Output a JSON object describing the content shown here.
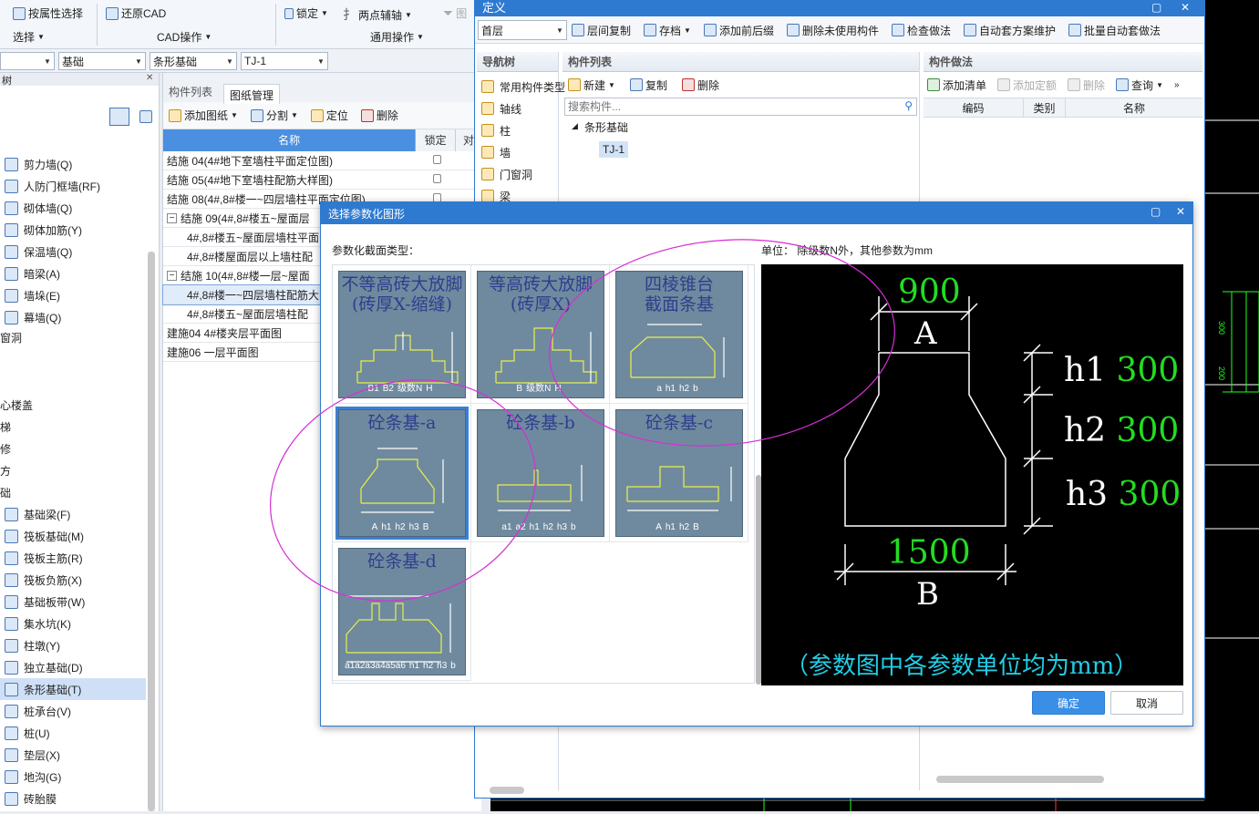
{
  "ribbon": {
    "select_by_attr": "按属性选择",
    "restore_cad": "还原CAD",
    "lock": "锁定",
    "two_point_aux": "两点辅轴",
    "select_group": "选择",
    "cad_ops_group": "CAD操作",
    "general_ops_group": "通用操作"
  },
  "filter_bar": {
    "combo1": "",
    "combo2": "基础",
    "combo3": "条形基础",
    "combo4": "TJ-1"
  },
  "left_nav": {
    "header": "树",
    "items": [
      {
        "label": "剪力墙(Q)",
        "icon": "shear-wall-icon"
      },
      {
        "label": "人防门框墙(RF)",
        "icon": "civil-defense-door-icon"
      },
      {
        "label": "砌体墙(Q)",
        "icon": "masonry-wall-icon"
      },
      {
        "label": "砌体加筋(Y)",
        "icon": "masonry-rebar-icon"
      },
      {
        "label": "保温墙(Q)",
        "icon": "insulation-wall-icon"
      },
      {
        "label": "暗梁(A)",
        "icon": "hidden-beam-icon"
      },
      {
        "label": "墙垛(E)",
        "icon": "wall-pier-icon"
      },
      {
        "label": "幕墙(Q)",
        "icon": "curtain-wall-icon"
      }
    ],
    "group_labels": [
      "窗洞",
      "心楼盖",
      "梯",
      "修",
      "方",
      "础"
    ],
    "foundation_items": [
      {
        "label": "基础梁(F)",
        "icon": "foundation-beam-icon"
      },
      {
        "label": "筏板基础(M)",
        "icon": "raft-foundation-icon"
      },
      {
        "label": "筏板主筋(R)",
        "icon": "raft-main-rebar-icon"
      },
      {
        "label": "筏板负筋(X)",
        "icon": "raft-neg-rebar-icon"
      },
      {
        "label": "基础板带(W)",
        "icon": "foundation-strip-icon"
      },
      {
        "label": "集水坑(K)",
        "icon": "sump-pit-icon"
      },
      {
        "label": "柱墩(Y)",
        "icon": "column-pier-icon"
      },
      {
        "label": "独立基础(D)",
        "icon": "isolated-foundation-icon"
      },
      {
        "label": "条形基础(T)",
        "icon": "strip-foundation-icon"
      },
      {
        "label": "桩承台(V)",
        "icon": "pile-cap-icon"
      },
      {
        "label": "桩(U)",
        "icon": "pile-icon"
      },
      {
        "label": "垫层(X)",
        "icon": "cushion-icon"
      },
      {
        "label": "地沟(G)",
        "icon": "trench-icon"
      },
      {
        "label": "砖胎膜",
        "icon": "brick-mould-icon"
      }
    ]
  },
  "drawing_panel": {
    "tabs": [
      "构件列表",
      "图纸管理"
    ],
    "toolbar": {
      "add": "添加图纸",
      "split": "分割",
      "locate": "定位",
      "delete": "删除"
    },
    "columns": [
      "名称",
      "锁定",
      "对"
    ],
    "rows": [
      {
        "name": "结施 04(4#地下室墙柱平面定位图)",
        "indent": 0
      },
      {
        "name": "结施 05(4#地下室墙柱配筋大样图)",
        "indent": 0
      },
      {
        "name": "结施 08(4#,8#楼一~四层墙柱平面定位图)",
        "indent": 0
      },
      {
        "name": "结施 09(4#,8#楼五~屋面层",
        "indent": 0,
        "toggle": "−"
      },
      {
        "name": "4#,8#楼五~屋面层墙柱平面",
        "indent": 1
      },
      {
        "name": "4#,8#楼屋面层以上墙柱配",
        "indent": 1
      },
      {
        "name": "结施 10(4#,8#楼一层~屋面",
        "indent": 0,
        "toggle": "−"
      },
      {
        "name": "4#,8#楼一~四层墙柱配筋大",
        "indent": 1,
        "selected": true
      },
      {
        "name": "4#,8#楼五~屋面层墙柱配",
        "indent": 1
      },
      {
        "name": "建施04 4#楼夹层平面图",
        "indent": 0
      },
      {
        "name": "建施06 一层平面图",
        "indent": 0
      }
    ]
  },
  "define_window": {
    "title": "定义",
    "floor": "首层",
    "toolbar": [
      "层间复制",
      "存档",
      "添加前后缀",
      "删除未使用构件",
      "检查做法",
      "自动套方案维护",
      "批量自动套做法"
    ],
    "nav_tree_header": "导航树",
    "nav_tree_items": [
      "常用构件类型",
      "轴线",
      "柱",
      "墙",
      "门窗洞",
      "梁"
    ],
    "component_list_header": "构件列表",
    "component_toolbar": {
      "new": "新建",
      "copy": "复制",
      "delete": "删除"
    },
    "search_placeholder": "搜索构件...",
    "tree_parent": "条形基础",
    "tree_child": "TJ-1",
    "method_header": "构件做法",
    "method_toolbar": {
      "add_list": "添加清单",
      "add_quota": "添加定额",
      "delete": "删除",
      "query": "查询"
    },
    "method_columns": [
      "编码",
      "类别",
      "名称"
    ]
  },
  "dialog": {
    "title": "选择参数化图形",
    "section_label": "参数化截面类型：",
    "unit_note": "单位： 除级数N外，其他参数为mm",
    "shapes": [
      {
        "title1": "不等高砖大放脚",
        "title2": "(砖厚X-缩缝)",
        "labels": [
          "B1",
          "B2",
          "级数N",
          "H"
        ]
      },
      {
        "title1": "等高砖大放脚",
        "title2": "(砖厚X)",
        "labels": [
          "B",
          "级数N",
          "H"
        ]
      },
      {
        "title1": "四棱锥台",
        "title2": "截面条基",
        "labels": [
          "a",
          "h1",
          "h2",
          "b"
        ]
      },
      {
        "title1": "砼条基-a",
        "labels": [
          "A",
          "h1",
          "h2",
          "h3",
          "B"
        ],
        "selected": true
      },
      {
        "title1": "砼条基-b",
        "labels": [
          "a1",
          "a2",
          "h1",
          "h2",
          "h3",
          "b"
        ]
      },
      {
        "title1": "砼条基-c",
        "labels": [
          "A",
          "h1",
          "h2",
          "B"
        ]
      },
      {
        "title1": "砼条基-d",
        "labels": [
          "a1a2a3a4a5a6",
          "h1",
          "h2",
          "h3",
          "b"
        ]
      }
    ],
    "preview": {
      "A_value": "900",
      "A_label": "A",
      "B_value": "1500",
      "B_label": "B",
      "h1_label": "h1",
      "h1_value": "300",
      "h2_label": "h2",
      "h2_value": "300",
      "h3_label": "h3",
      "h3_value": "300",
      "note": "（参数图中各参数单位均为mm）"
    },
    "ok": "确定",
    "cancel": "取消"
  },
  "cad_canvas": {
    "dim1": "300",
    "dim2": "200"
  },
  "colors": {
    "title_blue": "#2e7ad1",
    "selected_blue": "#3a7fd5",
    "preview_green": "#22dd22",
    "preview_cyan": "#22cde6",
    "annotation_magenta": "#d62ed6"
  }
}
